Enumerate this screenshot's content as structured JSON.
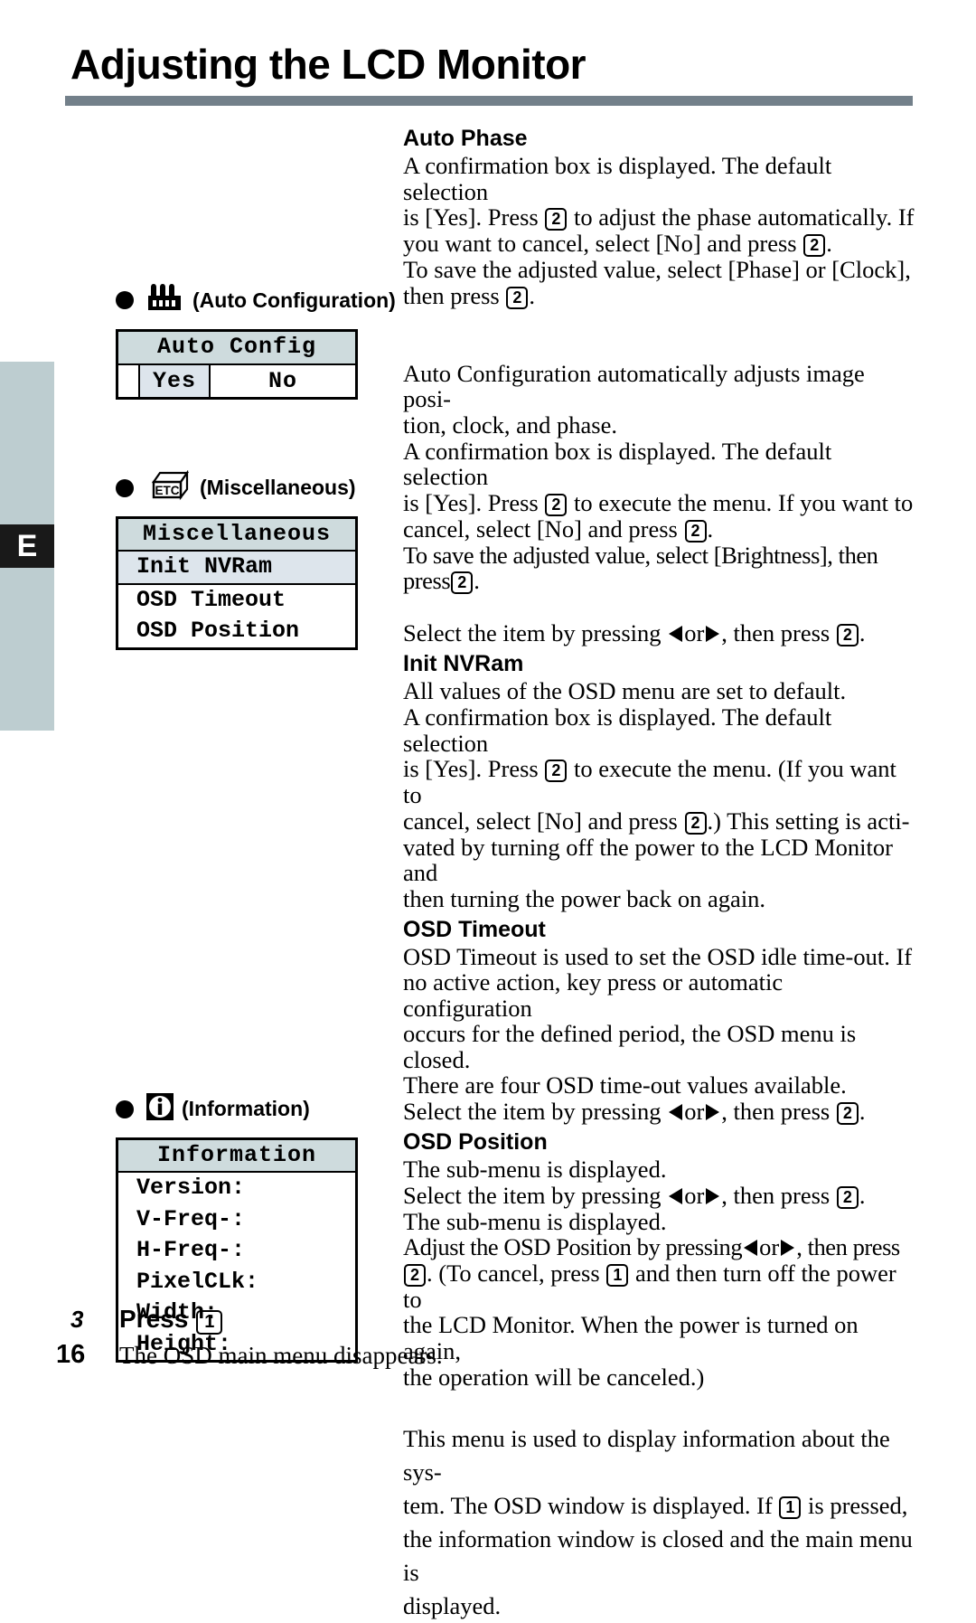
{
  "page": {
    "title": "Adjusting the LCD Monitor",
    "edge_tab_label": "E",
    "page_number": "16"
  },
  "auto_phase": {
    "heading": "Auto Phase",
    "line1": "A confirmation box is displayed. The default selection",
    "line2_a": "is [Yes]. Press",
    "key_a": "2",
    "line2_b": "to adjust the phase automatically. If",
    "line3_a": "you want to cancel, select [No] and press",
    "key_b": "2",
    "line3_b": ".",
    "line4": "To save the adjusted value, select [Phase] or [Clock],",
    "line5_a": "then press",
    "key_c": "2",
    "line5_b": "."
  },
  "auto_config": {
    "icon": "factory-icon",
    "heading": "(Auto Configuration)",
    "osd": {
      "title": "Auto Config",
      "yes": "Yes",
      "no": "No"
    },
    "line1": "Auto Configuration automatically adjusts image posi-",
    "line2": "tion, clock, and phase.",
    "line3": "A confirmation box is displayed. The default selection",
    "line4_a": "is [Yes]. Press",
    "key_a": "2",
    "line4_b": "to execute the menu. If you want to",
    "line5_a": "cancel, select [No] and press",
    "key_b": "2",
    "line5_b": ".",
    "line6_a": "To save the adjusted value, select [Brightness], then press",
    "key_c": "2",
    "line6_b": "."
  },
  "miscellaneous": {
    "icon": "etc-box-icon",
    "icon_label": "ETC",
    "heading": "(Miscellaneous)",
    "osd": {
      "title": "Miscellaneous",
      "items": [
        "Init NVRam",
        "OSD Timeout",
        "OSD Position"
      ]
    },
    "select_line_a": "Select the item by pressing",
    "select_line_or": "or",
    "select_line_b": ", then press",
    "select_key": "2",
    "select_line_c": "."
  },
  "init_nvram": {
    "heading": "Init NVRam",
    "line1": "All values of the OSD menu are set to default.",
    "line2": "A confirmation box is displayed. The default selection",
    "line3_a": "is [Yes]. Press",
    "key_a": "2",
    "line3_b": "to execute the menu. (If you want to",
    "line4_a": "cancel, select [No] and press",
    "key_b": "2",
    "line4_b": ".) This setting is acti-",
    "line5": "vated by turning off the power to the LCD Monitor and",
    "line6": "then turning the power back on again."
  },
  "osd_timeout": {
    "heading": "OSD Timeout",
    "line1": "OSD Timeout is used to set the OSD idle time-out.  If",
    "line2": "no active action, key press or automatic configuration",
    "line3": "occurs for the defined period, the OSD menu is closed.",
    "line4": "There are four OSD time-out values available.",
    "line5_a": "Select the item by pressing",
    "line5_or": "or",
    "line5_b": ", then press",
    "key_a": "2",
    "line5_c": "."
  },
  "osd_position": {
    "heading": "OSD Position",
    "line1": "The sub-menu is displayed.",
    "line2_a": "Select the item by pressing",
    "line2_or": "or",
    "line2_b": ", then press",
    "key_a": "2",
    "line2_c": ".",
    "line3": "The sub-menu is displayed.",
    "line4_a": "Adjust the OSD Position by pressing",
    "line4_or": "or",
    "line4_b": ", then press",
    "key_b": "2",
    "line5_a": ". (To cancel, press",
    "key_c": "1",
    "line5_b": "and then turn off the power to",
    "line6": "the LCD Monitor. When the power is turned on again,",
    "line7": "the operation will be canceled.)"
  },
  "information": {
    "icon": "info-icon",
    "icon_label": "i",
    "heading": "(Information)",
    "osd": {
      "title": "Information",
      "items": [
        "Version:",
        "V-Freq-:",
        "H-Freq-:",
        "PixelCLk:",
        "Width:",
        "Height:"
      ]
    },
    "line1": "This menu is used to display information about the sys-",
    "line2_a": "tem.  The OSD window is displayed.  If",
    "key_a": "1",
    "line2_b": "is pressed,",
    "line3": "the information window is closed and the main menu is",
    "line4": "displayed."
  },
  "footer": {
    "step_number": "3",
    "step_label": "Press",
    "step_key": "1",
    "note": "The OSD main menu disappears."
  }
}
